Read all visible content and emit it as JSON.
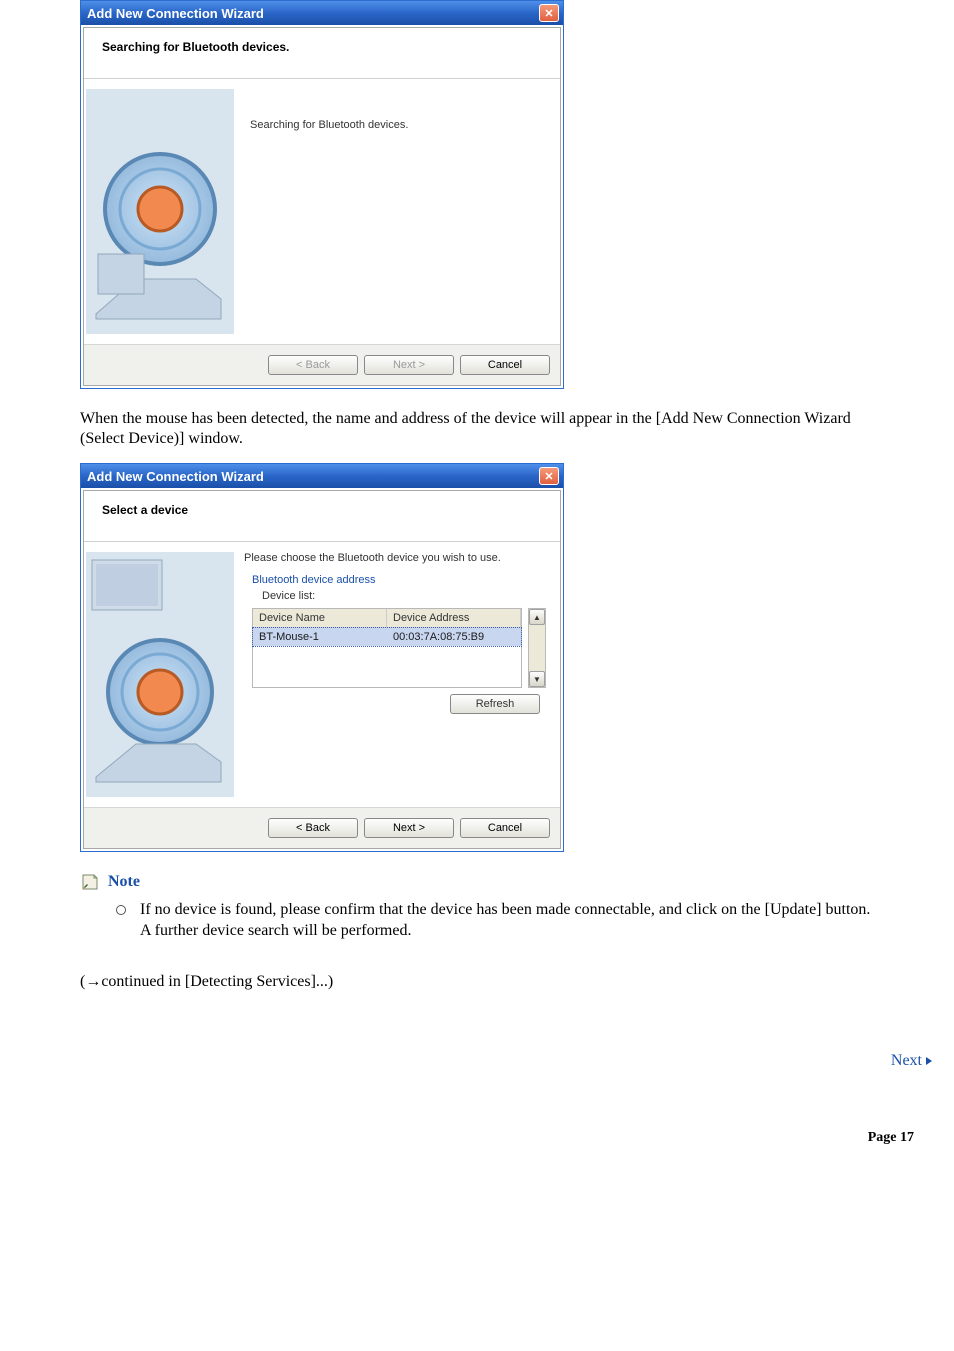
{
  "dialog1": {
    "title": "Add New Connection Wizard",
    "header": "Searching for Bluetooth devices.",
    "body_text": "Searching for Bluetooth devices.",
    "back": "< Back",
    "next": "Next >",
    "cancel": "Cancel"
  },
  "para1": "When the mouse has been detected, the name and address of the device will appear in the [Add New Connection Wizard (Select Device)] window.",
  "dialog2": {
    "title": "Add New Connection Wizard",
    "header": "Select a device",
    "instruction": "Please choose the Bluetooth device you wish to use.",
    "group_label": "Bluetooth device address",
    "list_label": "Device list:",
    "columns": [
      "Device Name",
      "Device Address"
    ],
    "rows": [
      {
        "name": "BT-Mouse-1",
        "addr": "00:03:7A:08:75:B9"
      }
    ],
    "refresh": "Refresh",
    "back": "< Back",
    "next": "Next >",
    "cancel": "Cancel"
  },
  "note": {
    "title": "Note",
    "item1_line1": "If no device is found, please confirm that the device has been made connectable, and click on the [Update] button.",
    "item1_line2": "A further device search will be performed."
  },
  "continued": "(→continued in [Detecting Services]...)",
  "next_link": "Next",
  "page_number": "Page 17"
}
